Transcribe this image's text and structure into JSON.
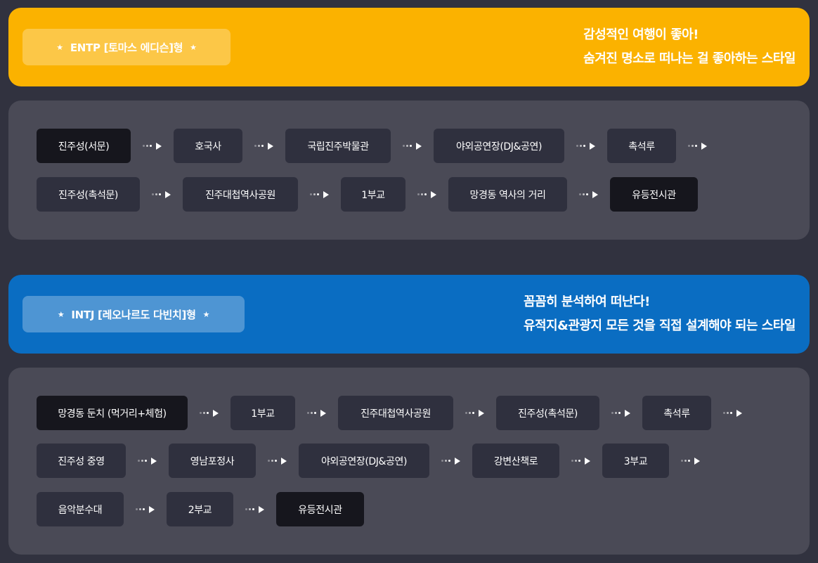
{
  "sections": [
    {
      "badge": "ENTP [토마스 에디슨]형",
      "tagline": [
        "감성적인 여행이 좋아!",
        "숨겨진 명소로 떠나는 걸 좋아하는 스타일"
      ],
      "rows": [
        [
          "진주성(서문)",
          "호국사",
          "국립진주박물관",
          "야외공연장(DJ&공연)",
          "촉석루"
        ],
        [
          "진주성(촉석문)",
          "진주대첩역사공원",
          "1부교",
          "망경동 역사의 거리",
          "유등전시관"
        ]
      ]
    },
    {
      "badge": "INTJ [레오나르도 다빈치]형",
      "tagline": [
        "꼼꼼히 분석하여 떠난다!",
        "유적지&관광지 모든 것을 직접 설계해야 되는 스타일"
      ],
      "rows": [
        [
          "망경동 둔치 (먹거리+체험)",
          "1부교",
          "진주대첩역사공원",
          "진주성(촉석문)",
          "촉석루"
        ],
        [
          "진주성 중영",
          "영남포정사",
          "야외공연장(DJ&공연)",
          "강변산책로",
          "3부교"
        ],
        [
          "음악분수대",
          "2부교",
          "유등전시관"
        ]
      ]
    }
  ],
  "colors": {
    "entp": "#fbb200",
    "intj": "#0a6dc2",
    "panel": "#4a4a56",
    "chip": "#2f303e",
    "chip_highlight": "#16161d"
  }
}
